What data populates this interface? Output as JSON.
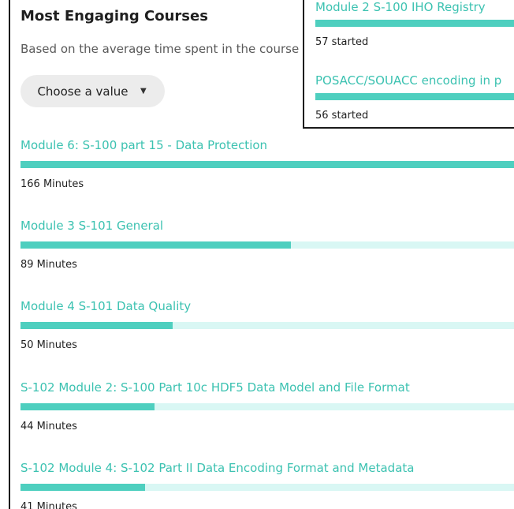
{
  "card": {
    "title": "Most Engaging Courses",
    "subtitle": "Based on the average time spent in the course",
    "select": {
      "value": "Choose a value",
      "caret_icon": "caret-down-icon"
    },
    "courses": [
      {
        "name": "Module 6: S-100 part 15 - Data Protection",
        "minutes_label": "166 Minutes",
        "minutes": 166
      },
      {
        "name": "Module 3 S-101 General",
        "minutes_label": "89 Minutes",
        "minutes": 89
      },
      {
        "name": "Module 4 S-101 Data Quality",
        "minutes_label": "50 Minutes",
        "minutes": 50
      },
      {
        "name": "S-102 Module 2: S-100 Part 10c HDF5 Data Model and File Format",
        "minutes_label": "44 Minutes",
        "minutes": 44
      },
      {
        "name": "S-102 Module 4: S-102 Part II Data Encoding Format and Metadata",
        "minutes_label": "41 Minutes",
        "minutes": 41
      }
    ]
  },
  "popup": {
    "items": [
      {
        "name": "Module 2 S-100 IHO Registry",
        "count_label": "57 started"
      },
      {
        "name": "POSACC/SOUACC encoding in p",
        "count_label": "56 started"
      }
    ]
  },
  "colors": {
    "accent": "#3cc2b1",
    "bar_fill": "#4ecfbf",
    "bar_track": "#d9f7f4",
    "border": "#1a1a1a"
  }
}
